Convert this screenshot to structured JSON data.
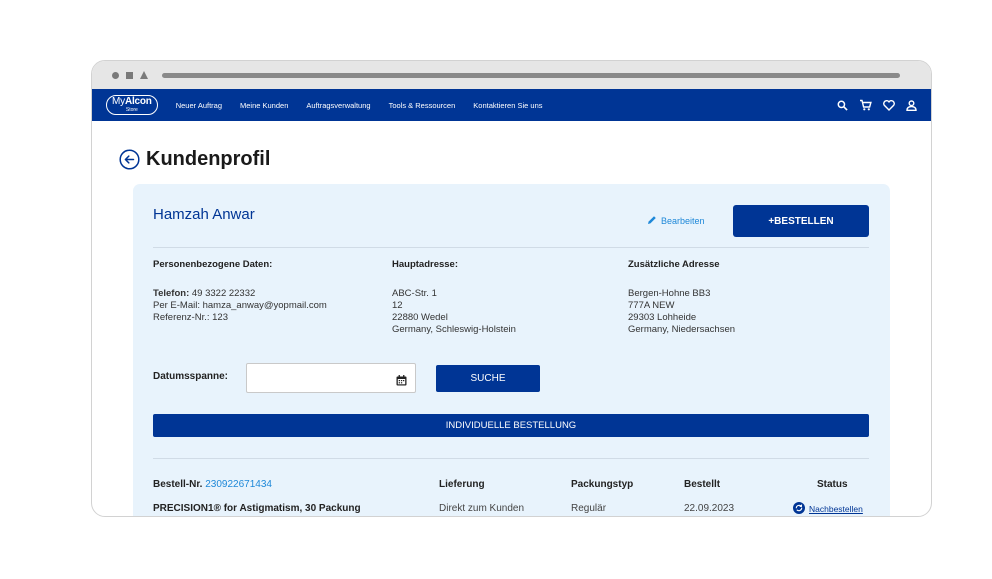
{
  "nav": {
    "logo_prefix": "My",
    "logo_brand": "Alcon",
    "logo_sub": "Store",
    "links": [
      "Neuer Auftrag",
      "Meine Kunden",
      "Auftragsverwaltung",
      "Tools & Ressourcen",
      "Kontaktieren Sie uns"
    ],
    "icons": [
      "search-icon",
      "cart-icon",
      "heart-icon",
      "user-icon"
    ],
    "color": "#003595"
  },
  "page": {
    "title": "Kundenprofil"
  },
  "customer": {
    "name": "Hamzah Anwar",
    "edit_label": "Bearbeiten",
    "order_button": "+BESTELLEN",
    "personal": {
      "heading": "Personenbezogene Daten:",
      "phone_label": "Telefon:",
      "phone": "49 3322 22332",
      "email_line": "Per E-Mail: hamza_anway@yopmail.com",
      "reference_line": "Referenz-Nr.: 123"
    },
    "main_address": {
      "heading": "Hauptadresse:",
      "lines": [
        "ABC-Str. 1",
        "12",
        "22880 Wedel",
        "Germany, Schleswig-Holstein"
      ]
    },
    "extra_address": {
      "heading": "Zusätzliche Adresse",
      "lines": [
        "Bergen-Hohne BB3",
        "777A NEW",
        "29303 Lohheide",
        "Germany, Niedersachsen"
      ]
    }
  },
  "filter": {
    "date_label": "Datumsspanne:",
    "date_value": "",
    "search_button": "SUCHE",
    "individual_order": "INDIVIDUELLE BESTELLUNG"
  },
  "orders": {
    "headers": {
      "order_no_label": "Bestell-Nr.",
      "order_no": "230922671434",
      "delivery": "Lieferung",
      "package": "Packungstyp",
      "ordered": "Bestellt",
      "status": "Status"
    },
    "rows": [
      {
        "product": "PRECISION1® for Astigmatism, 30 Packung",
        "delivery": "Direkt zum Kunden",
        "package": "Regulär",
        "ordered": "22.09.2023",
        "status": "Nachbestellen"
      }
    ]
  }
}
